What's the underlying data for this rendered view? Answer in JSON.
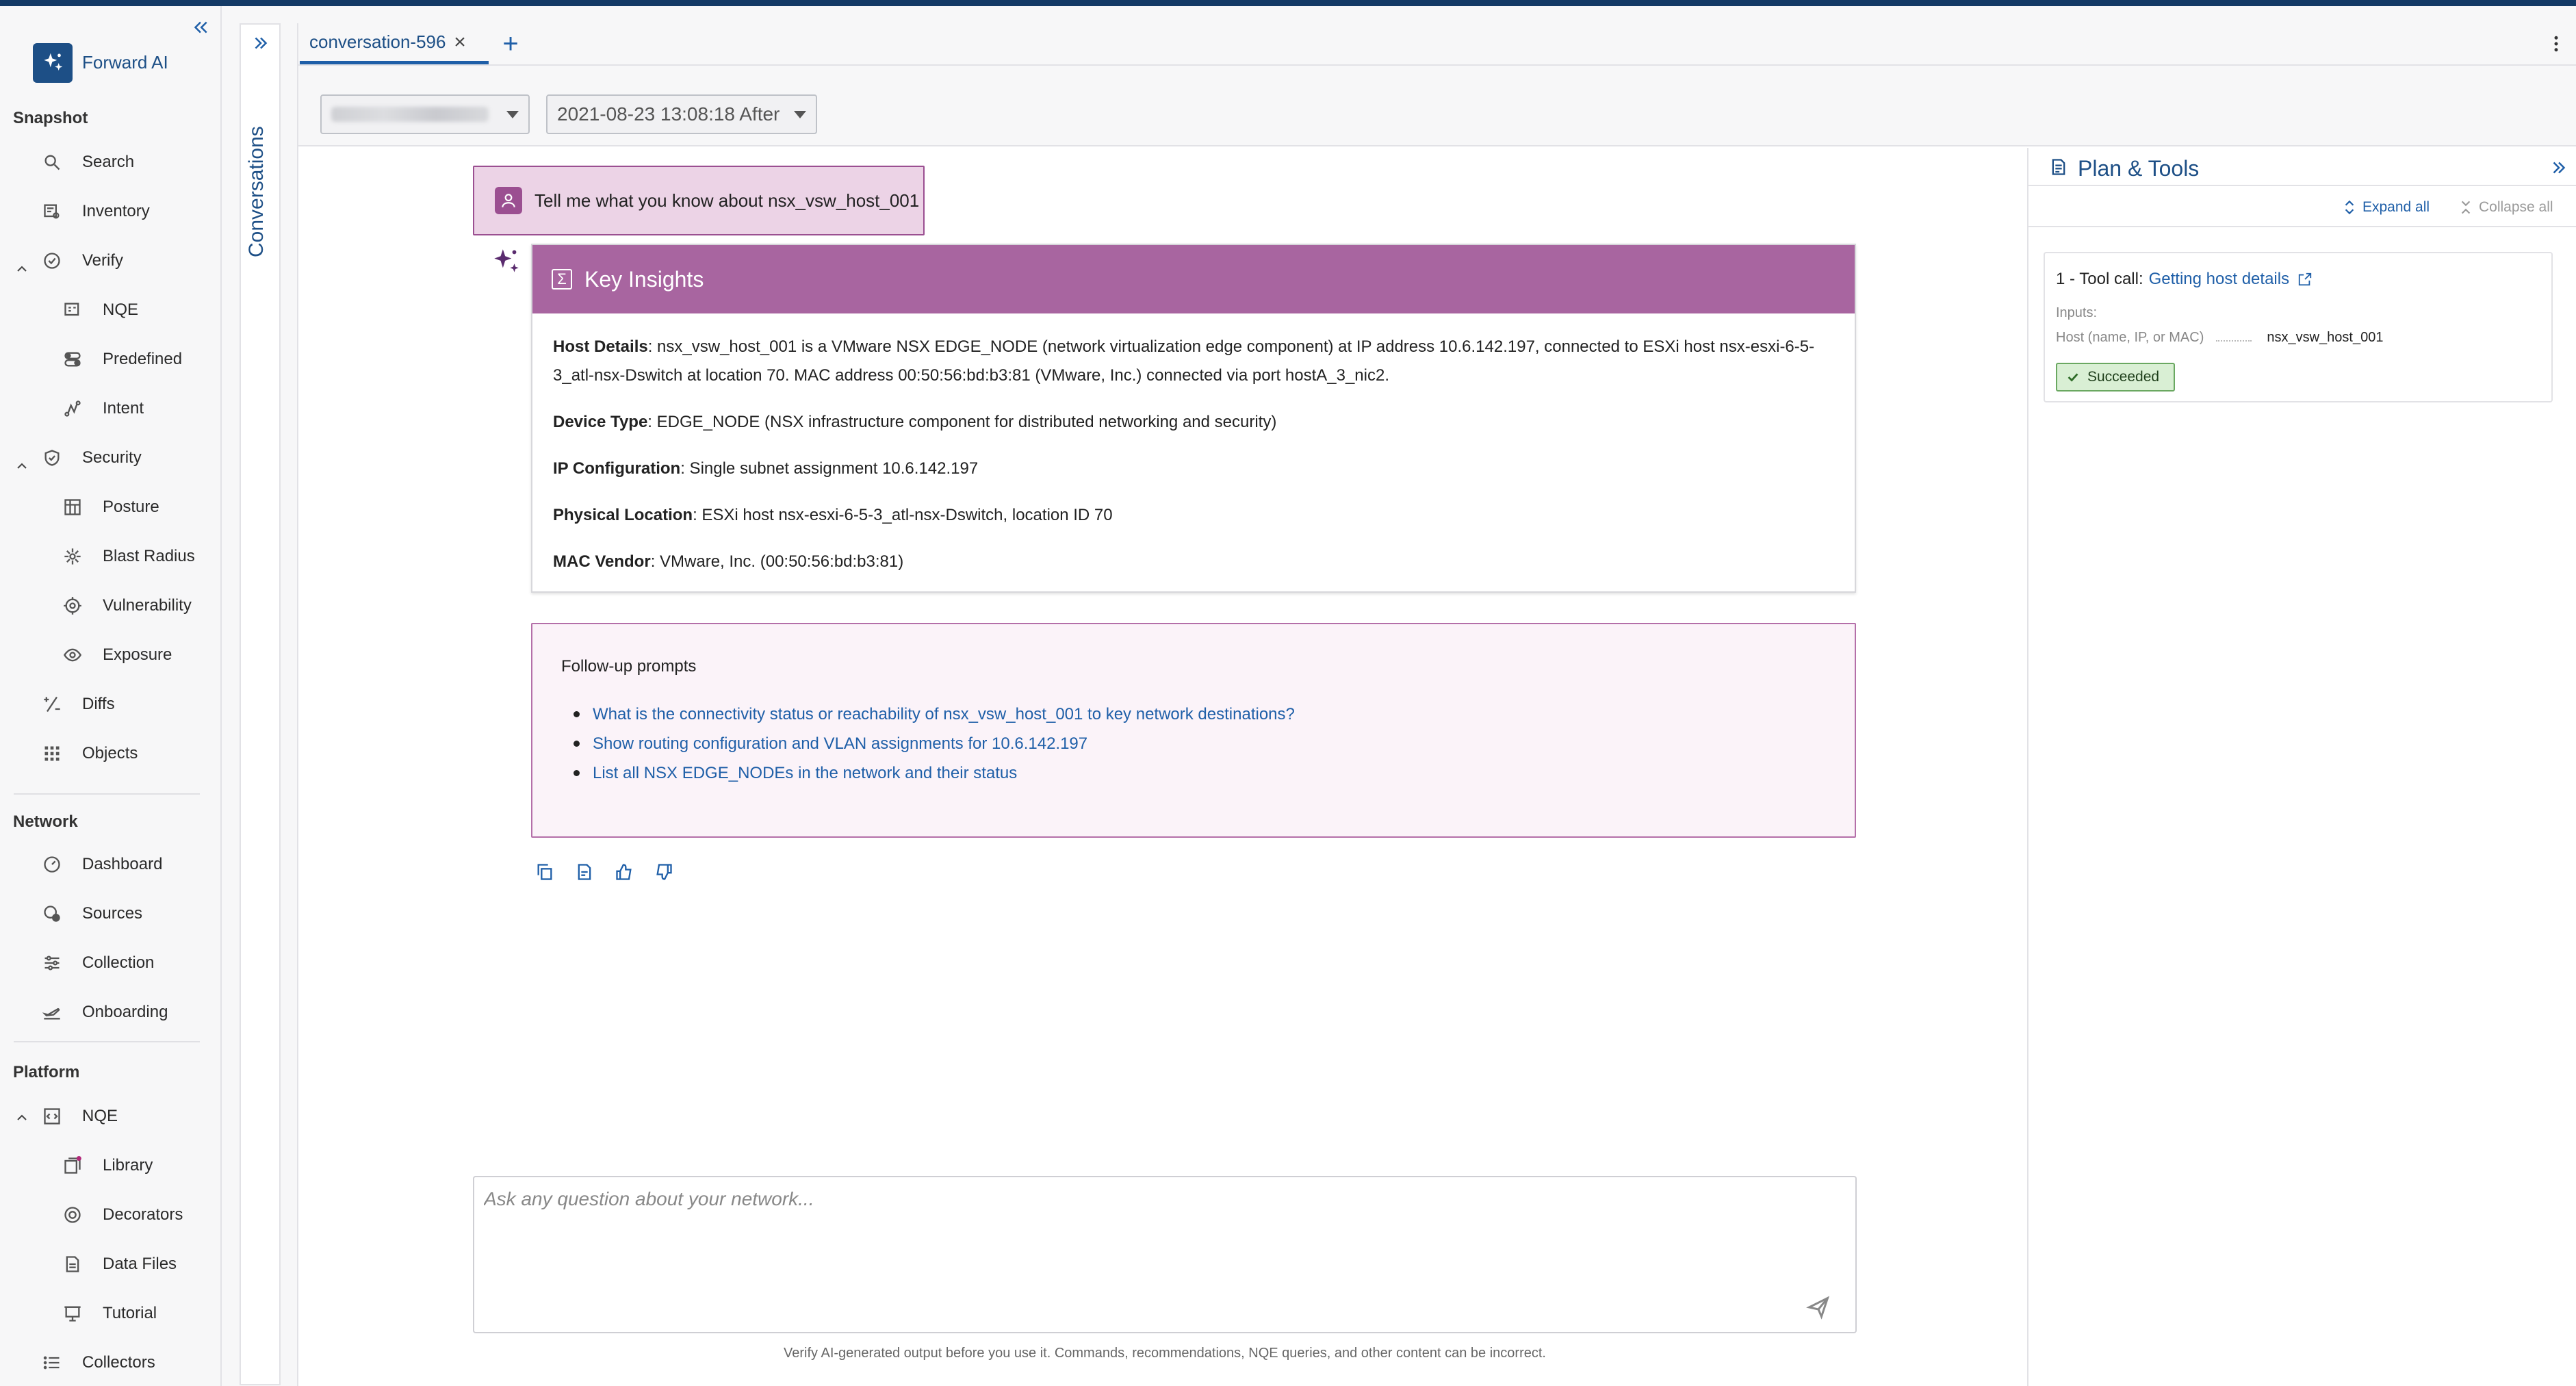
{
  "app": {
    "name": "Forward AI"
  },
  "nav": {
    "sections": [
      {
        "title": "Snapshot"
      },
      {
        "title": "Network"
      },
      {
        "title": "Platform"
      }
    ],
    "snapshot_items": [
      "Search",
      "Inventory",
      "Verify",
      "NQE",
      "Predefined",
      "Intent",
      "Security",
      "Posture",
      "Blast Radius",
      "Vulnerability",
      "Exposure",
      "Diffs",
      "Objects"
    ],
    "network_items": [
      "Dashboard",
      "Sources",
      "Collection",
      "Onboarding"
    ],
    "platform_items": [
      "NQE",
      "Library",
      "Decorators",
      "Data Files",
      "Tutorial",
      "Collectors"
    ]
  },
  "rail": {
    "label": "Conversations"
  },
  "tabs": [
    {
      "label": "conversation-596",
      "active": true
    }
  ],
  "filters": {
    "network_select": "",
    "snapshot_select": "2021-08-23 13:08:18 After"
  },
  "chat": {
    "user_message": "Tell me what you know about nsx_vsw_host_001",
    "insights": {
      "title": "Key Insights",
      "items": [
        {
          "label": "Host Details",
          "text": ": nsx_vsw_host_001 is a VMware NSX EDGE_NODE (network virtualization edge component) at IP address 10.6.142.197, connected to ESXi host nsx-esxi-6-5-3_atl-nsx-Dswitch at location 70. MAC address 00:50:56:bd:b3:81 (VMware, Inc.) connected via port hostA_3_nic2."
        },
        {
          "label": "Device Type",
          "text": ": EDGE_NODE (NSX infrastructure component for distributed networking and security)"
        },
        {
          "label": "IP Configuration",
          "text": ": Single subnet assignment 10.6.142.197"
        },
        {
          "label": "Physical Location",
          "text": ": ESXi host nsx-esxi-6-5-3_atl-nsx-Dswitch, location ID 70"
        },
        {
          "label": "MAC Vendor",
          "text": ": VMware, Inc. (00:50:56:bd:b3:81)"
        }
      ]
    },
    "followup": {
      "title": "Follow-up prompts",
      "items": [
        "What is the connectivity status or reachability of nsx_vsw_host_001 to key network destinations?",
        "Show routing configuration and VLAN assignments for 10.6.142.197",
        "List all NSX EDGE_NODEs in the network and their status"
      ]
    },
    "input_placeholder": "Ask any question about your network...",
    "disclaimer": "Verify AI-generated output before you use it. Commands, recommendations, NQE queries, and other content can be incorrect."
  },
  "plan": {
    "title": "Plan & Tools",
    "expand_all": "Expand all",
    "collapse_all": "Collapse all",
    "tool_call": {
      "prefix": "1 - Tool call:",
      "name": "Getting host details",
      "inputs_label": "Inputs:",
      "input_key": "Host (name, IP, or MAC)",
      "input_value": "nsx_vsw_host_001",
      "status": "Succeeded"
    }
  },
  "colors": {
    "brand": "#1d4f86",
    "accent": "#1f5fa8",
    "insights_header": "#a865a0",
    "user_bubble": "#ecd3e6",
    "success": "#d9efd4"
  }
}
